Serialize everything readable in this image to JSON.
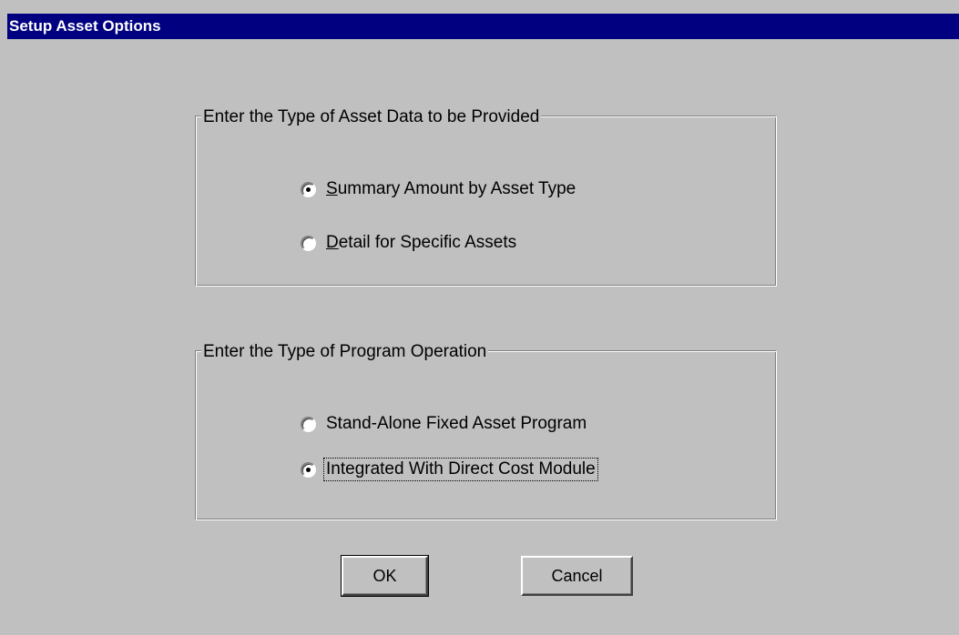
{
  "window": {
    "title": "Setup Asset Options"
  },
  "group_asset_data": {
    "legend": "Enter the Type of Asset Data to be Provided",
    "options": [
      {
        "label_rest": "ummary Amount by Asset Type",
        "mnemonic": "S",
        "checked": true
      },
      {
        "label_rest": "etail for Specific Assets",
        "mnemonic": "D",
        "checked": false
      }
    ]
  },
  "group_program_operation": {
    "legend": "Enter the Type of Program Operation",
    "options": [
      {
        "label": "Stand-Alone Fixed Asset Program",
        "checked": false
      },
      {
        "label": "Integrated With Direct Cost Module",
        "checked": true,
        "focused": true
      }
    ]
  },
  "buttons": {
    "ok": "OK",
    "cancel": "Cancel"
  },
  "colors": {
    "titlebar": "#000080",
    "face": "#c0c0c0"
  }
}
